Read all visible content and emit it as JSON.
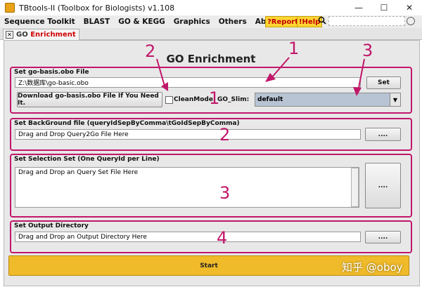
{
  "window": {
    "title": "TBtools-II (Toolbox for Biologists) v1.108",
    "minimize": "—",
    "maximize": "☐",
    "close": "✕"
  },
  "menu": [
    "Sequence Toolkit",
    "BLAST",
    "GO & KEGG",
    "Graphics",
    "Others",
    "About"
  ],
  "toolbar": {
    "report": "?Report",
    "help": "!Help",
    "search_icon": "search-icon",
    "search_value": ""
  },
  "tab": {
    "prefix": "GO ",
    "name": "Enrichment"
  },
  "page_title": "GO Enrichment",
  "obo": {
    "section_title": "Set go-basis.obo File",
    "path": "Z:\\数据库\\go-basic.obo",
    "set_button": "Set",
    "download_button": "Download go-basis.obo File If You Need It.",
    "cleanmode_label": "CleanMode",
    "goslim_label": "GO_Slim:",
    "goslim_value": "default"
  },
  "background": {
    "section_title": "Set BackGround file (queryIdSepByComma\\tGoIdSepByComma)",
    "placeholder": "Drag and Drop Query2Go File Here",
    "browse_button": "...."
  },
  "selection": {
    "section_title": "Set Selection Set (One QueryId per Line)",
    "placeholder": "Drag and Drop an Query Set File Here",
    "browse_button": "...."
  },
  "output": {
    "section_title": "Set Output Directory",
    "placeholder": "Drag and Drop an Output Directory Here",
    "browse_button": "...."
  },
  "start_button": "Start",
  "annotations": {
    "n1": "1",
    "n2": "2",
    "n3": "3",
    "s1": "1",
    "s2": "2",
    "s3": "3",
    "s4": "4",
    "color": "#c0176a"
  },
  "watermark": "知乎 @oboy"
}
